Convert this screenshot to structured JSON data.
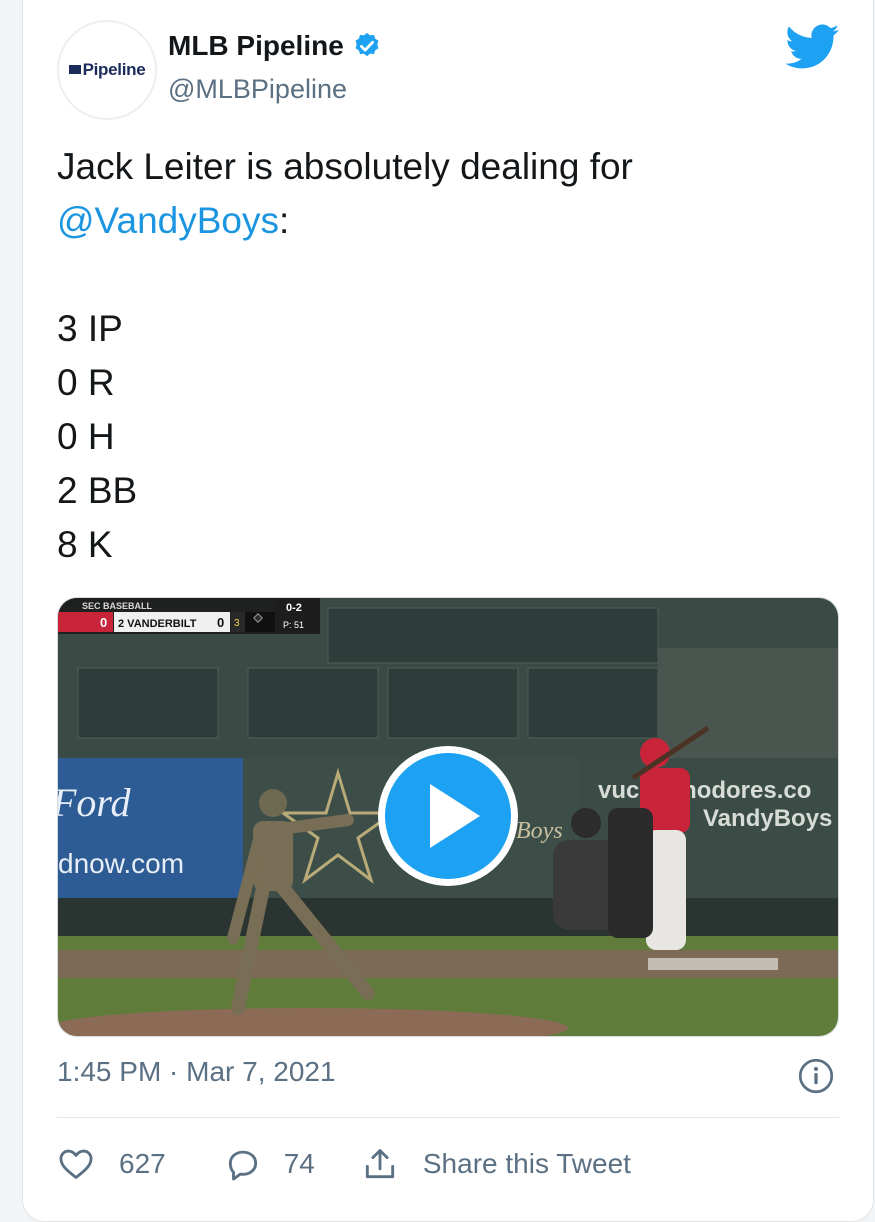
{
  "account": {
    "avatar_text": "Pipeline",
    "name": "MLB Pipeline",
    "handle": "@MLBPipeline"
  },
  "tweet": {
    "text_before": "Jack Leiter is absolutely dealing for\n",
    "mention": "@VandyBoys",
    "text_after": ":",
    "stats": [
      "3 IP",
      "0 R",
      "0 H",
      "2 BB",
      "8 K"
    ]
  },
  "video": {
    "scorebug": {
      "league": "SEC BASEBALL",
      "away_score": "0",
      "home_label": "2 VANDERBILT",
      "home_score": "0",
      "inning": "3",
      "count": "0-2",
      "pitches": "P: 51"
    },
    "wall_left": [
      "Ford",
      "dnow.com"
    ],
    "wall_right": [
      "vucommodores.co",
      "VandyBoys",
      "Boys"
    ]
  },
  "meta": {
    "timestamp": "1:45 PM · Mar 7, 2021"
  },
  "actions": {
    "likes": "627",
    "replies": "74",
    "share_label": "Share this Tweet"
  },
  "colors": {
    "link": "#1b95e0",
    "twitter_blue": "#1da1f2",
    "text": "#14171a",
    "secondary": "#5b7083"
  }
}
